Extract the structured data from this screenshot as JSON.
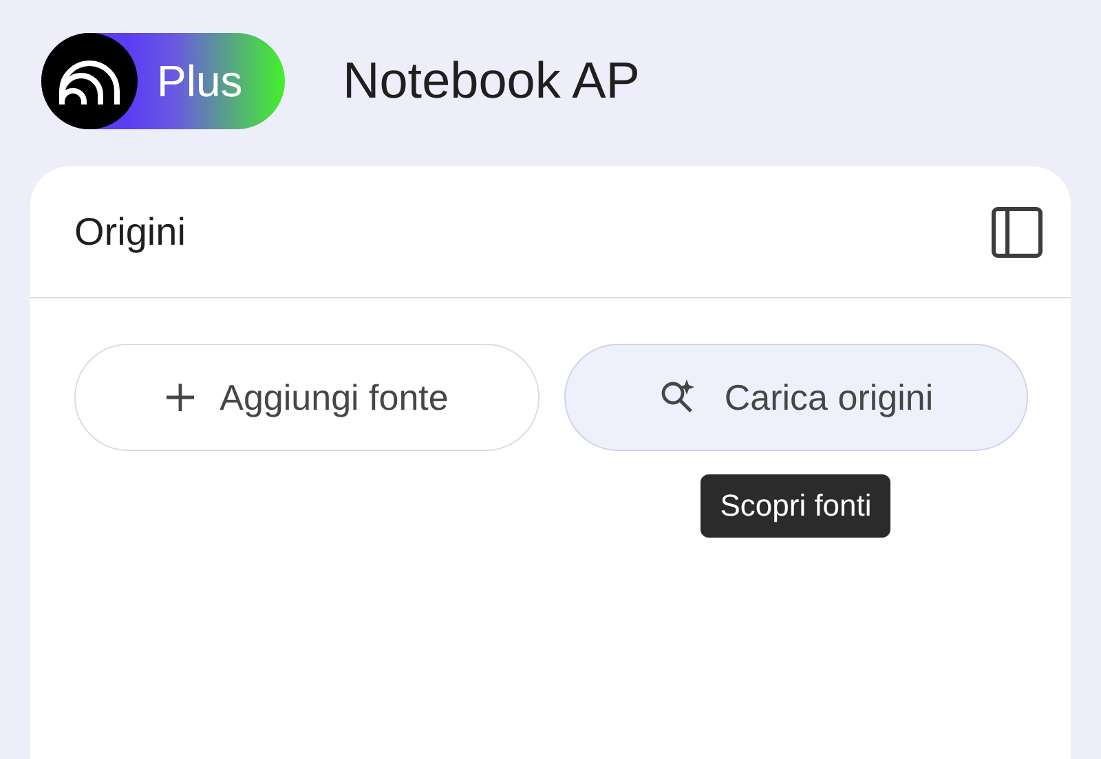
{
  "header": {
    "badge": "Plus",
    "title": "Notebook AP"
  },
  "panel": {
    "title": "Origini",
    "buttons": [
      {
        "kind": "add",
        "label": "Aggiungi fonte",
        "highlighted": false
      },
      {
        "kind": "discover",
        "label": "Carica origini",
        "highlighted": true,
        "tooltip": "Scopri fonti"
      }
    ]
  }
}
